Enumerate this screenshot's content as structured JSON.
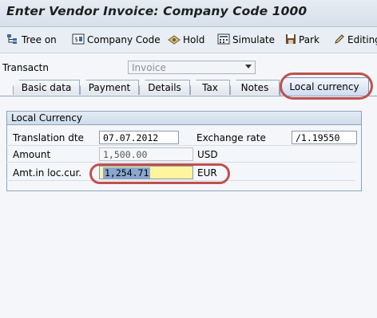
{
  "title": "Enter Vendor Invoice: Company Code 1000",
  "toolbar": {
    "tree_on": "Tree on",
    "company_code": "Company Code",
    "hold": "Hold",
    "simulate": "Simulate",
    "park": "Park",
    "editing": "Editing"
  },
  "transaction": {
    "label": "Transactn",
    "value": "Invoice"
  },
  "tabs": [
    {
      "label": "Basic data"
    },
    {
      "label": "Payment"
    },
    {
      "label": "Details"
    },
    {
      "label": "Tax"
    },
    {
      "label": "Notes"
    },
    {
      "label": "Local currency"
    }
  ],
  "active_tab": "Local currency",
  "group": {
    "title": "Local Currency",
    "translation_date_label": "Translation dte",
    "translation_date": "07.07.2012",
    "exchange_rate_label": "Exchange rate",
    "exchange_rate": "/1.19550",
    "amount_label": "Amount",
    "amount": "1,500.00",
    "amount_currency": "USD",
    "amount_local_label": "Amt.in loc.cur.",
    "amount_local": "1,254.71",
    "amount_local_currency": "EUR"
  },
  "colors": {
    "highlight_ring": "#c0504d",
    "selected_field": "#fff59d"
  }
}
